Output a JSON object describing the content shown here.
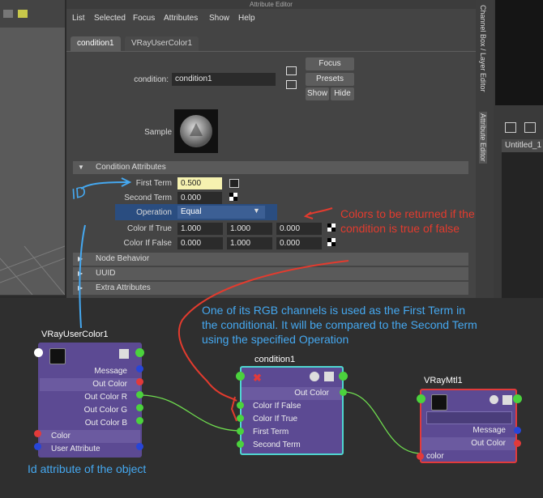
{
  "attribute_editor": {
    "title": "Attribute Editor",
    "menu": [
      "List",
      "Selected",
      "Focus",
      "Attributes",
      "Show",
      "Help"
    ],
    "tabs": [
      "condition1",
      "VRayUserColor1"
    ],
    "condition_label": "condition:",
    "condition_value": "condition1",
    "buttons": {
      "focus": "Focus",
      "presets": "Presets",
      "show": "Show",
      "hide": "Hide"
    },
    "sample_label": "Sample",
    "sections": {
      "condition_attributes": "Condition Attributes",
      "node_behavior": "Node Behavior",
      "uuid": "UUID",
      "extra_attributes": "Extra Attributes"
    },
    "attrs": {
      "first_term_label": "First Term",
      "first_term_value": "0.500",
      "second_term_label": "Second Term",
      "second_term_value": "0.000",
      "operation_label": "Operation",
      "operation_value": "Equal",
      "color_true_label": "Color If True",
      "color_true": [
        "1.000",
        "1.000",
        "0.000"
      ],
      "color_false_label": "Color If False",
      "color_false": [
        "0.000",
        "1.000",
        "0.000"
      ]
    }
  },
  "side_tabs": [
    "Channel Box / Layer Editor",
    "Attribute Editor"
  ],
  "right_panel": {
    "tab": "Untitled_1"
  },
  "nodes": {
    "vray_user_color": {
      "title": "VRayUserColor1",
      "rows": [
        "Message",
        "Out Color",
        "Out Color R",
        "Out Color G",
        "Out Color B",
        "Color",
        "User Attribute"
      ]
    },
    "condition": {
      "title": "condition1",
      "rows": [
        "Out Color",
        "Color If False",
        "Color If True",
        "First Term",
        "Second Term"
      ]
    },
    "vray_mtl": {
      "title": "VRayMtl1",
      "rows": [
        "Message",
        "Out Color",
        "color"
      ]
    }
  },
  "annotations": {
    "id": "ID",
    "colors_note": "Colors to be returned if the condition is true of false",
    "rgb_note": "One of its RGB channels is used as the First Term in the conditional. It will be compared to the Second Term using the specified Operation",
    "id_note": "Id attribute of the object"
  },
  "colors": {
    "node_body": "#5c4a93",
    "cyan_select": "#4fd6d0",
    "red_select": "#e23a3a",
    "annot_blue": "#45a8f0",
    "annot_red": "#e33b2e",
    "field_highlight": "#f6f2b0"
  }
}
